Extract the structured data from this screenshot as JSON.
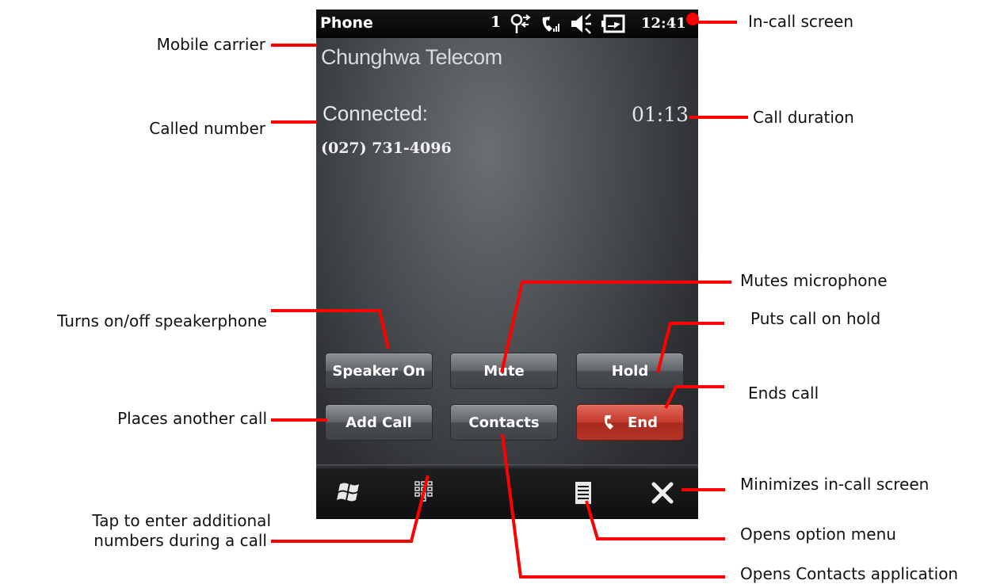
{
  "statusbar": {
    "title": "Phone",
    "signal_number": "1",
    "time": "12:41",
    "icons": [
      "data-connection-icon",
      "call-signal-icon",
      "volume-icon",
      "battery-charging-icon"
    ]
  },
  "call": {
    "carrier": "Chunghwa Telecom",
    "status": "Connected:",
    "duration": "01:13",
    "number": "(027) 731-4096"
  },
  "buttons": {
    "speaker": "Speaker On",
    "mute": "Mute",
    "hold": "Hold",
    "add_call": "Add Call",
    "contacts": "Contacts",
    "end": "End"
  },
  "bottom_bar": {
    "icons": [
      "windows-start-icon",
      "keypad-icon",
      "menu-icon",
      "close-icon"
    ]
  },
  "colors": {
    "accent": "#ff0000",
    "end_button": "#c63c2e",
    "screen_bg": "#4a4d51"
  },
  "annotations": {
    "in_call_screen": "In-call screen",
    "mobile_carrier": "Mobile carrier",
    "call_duration": "Call duration",
    "called_number": "Called number",
    "mutes_microphone": "Mutes microphone",
    "speakerphone": "Turns on/off speakerphone",
    "hold": "Puts call on hold",
    "ends_call": "Ends call",
    "another_call": "Places another call",
    "minimizes": "Minimizes in-call screen",
    "additional_numbers_1": "Tap to enter additional",
    "additional_numbers_2": "numbers during a call",
    "option_menu": "Opens option menu",
    "contacts_app": "Opens Contacts application"
  }
}
